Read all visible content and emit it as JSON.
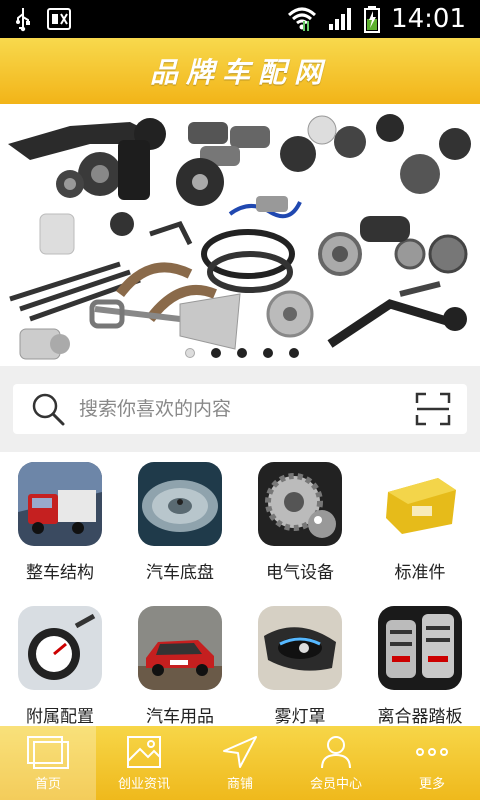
{
  "status_bar": {
    "time": "14:01"
  },
  "header": {
    "title": "品牌车配网"
  },
  "search": {
    "placeholder": "搜索你喜欢的内容"
  },
  "categories": [
    {
      "label": "整车结构"
    },
    {
      "label": "汽车底盘"
    },
    {
      "label": "电气设备"
    },
    {
      "label": "标准件"
    },
    {
      "label": "附属配置"
    },
    {
      "label": "汽车用品"
    },
    {
      "label": "雾灯罩"
    },
    {
      "label": "离合器踏板"
    }
  ],
  "tabs": [
    {
      "label": "首页"
    },
    {
      "label": "创业资讯"
    },
    {
      "label": "商铺"
    },
    {
      "label": "会员中心"
    },
    {
      "label": "更多"
    }
  ],
  "colors": {
    "accent": "#f2b418",
    "header_top": "#f8d94d"
  }
}
